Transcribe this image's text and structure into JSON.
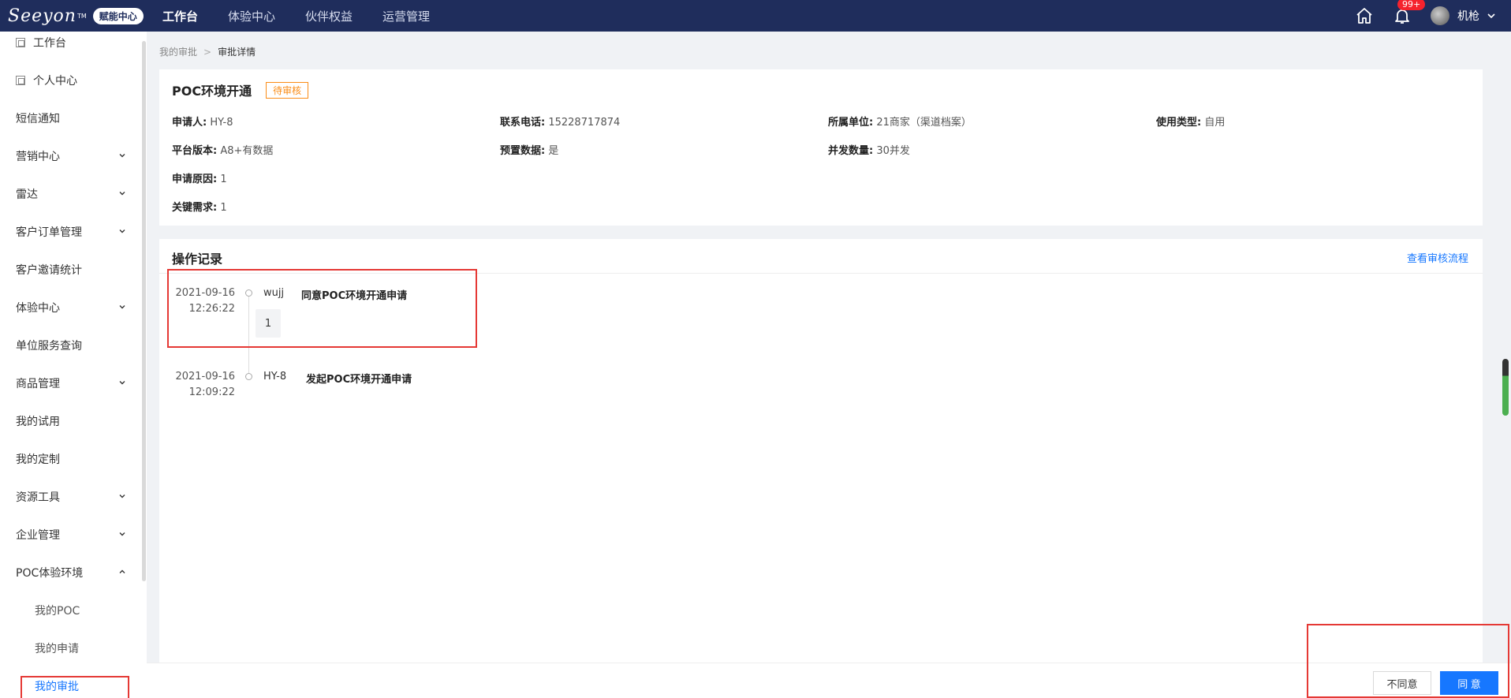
{
  "header": {
    "logo": "Seeyon",
    "logo_tm": "TM",
    "badge": "赋能中心",
    "nav": [
      "工作台",
      "体验中心",
      "伙伴权益",
      "运营管理"
    ],
    "notifications": "99+",
    "username": "机枪"
  },
  "sidebar": {
    "items": [
      {
        "label": "工作台"
      },
      {
        "label": "个人中心"
      },
      {
        "label": "短信通知"
      },
      {
        "label": "营销中心"
      },
      {
        "label": "雷达"
      },
      {
        "label": "客户订单管理"
      },
      {
        "label": "客户邀请统计"
      },
      {
        "label": "体验中心"
      },
      {
        "label": "单位服务查询"
      },
      {
        "label": "商品管理"
      },
      {
        "label": "我的试用"
      },
      {
        "label": "我的定制"
      },
      {
        "label": "资源工具"
      },
      {
        "label": "企业管理"
      },
      {
        "label": "POC体验环境"
      },
      {
        "label": "我的POC"
      },
      {
        "label": "我的申请"
      },
      {
        "label": "我的审批"
      }
    ]
  },
  "breadcrumb": {
    "parent": "我的审批",
    "sep": ">",
    "current": "审批详情"
  },
  "detail": {
    "title": "POC环境开通",
    "status": "待审核",
    "fields": {
      "applicant": {
        "label": "申请人:",
        "value": "HY-8"
      },
      "phone": {
        "label": "联系电话:",
        "value": "15228717874"
      },
      "unit": {
        "label": "所属单位:",
        "value": "21商家（渠道档案）"
      },
      "usage": {
        "label": "使用类型:",
        "value": "自用"
      },
      "version": {
        "label": "平台版本:",
        "value": "A8+有数据"
      },
      "preset": {
        "label": "预置数据:",
        "value": "是"
      },
      "concurrency": {
        "label": "并发数量:",
        "value": "30并发"
      },
      "reason": {
        "label": "申请原因:",
        "value": "1"
      },
      "requirement": {
        "label": "关键需求:",
        "value": "1"
      }
    }
  },
  "records": {
    "title": "操作记录",
    "flow_link": "查看审核流程",
    "items": [
      {
        "date": "2021-09-16",
        "time": "12:26:22",
        "user": "wujj",
        "action": "同意POC环境开通申请",
        "comment": "1"
      },
      {
        "date": "2021-09-16",
        "time": "12:09:22",
        "user": "HY-8",
        "action": "发起POC环境开通申请"
      }
    ]
  },
  "footer": {
    "reject": "不同意",
    "agree": "同 意"
  }
}
